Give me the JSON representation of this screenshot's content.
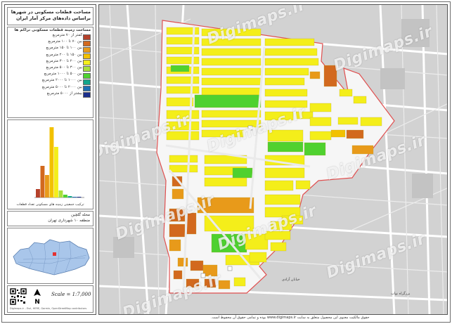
{
  "title": {
    "line1": "مساحت قطعات مسکونی در شهرها",
    "line2": "براساس داده‌های مرکز آمار ایران"
  },
  "legend": {
    "heading": "مساحت زمینه قطعات مسکونی تراکم ها",
    "items": [
      {
        "label": "کمتر از ۷۰ مترمربع",
        "color": "#b5412b"
      },
      {
        "label": "بین ۷۰ تا ۱۰۰ مترمربع",
        "color": "#d2691e"
      },
      {
        "label": "بین ۱۰۰ تا ۱۵۰ مترمربع",
        "color": "#e89a1a"
      },
      {
        "label": "بین ۱۵۰ تا ۲۰۰ مترمربع",
        "color": "#f2c100"
      },
      {
        "label": "بین ۲۰۰ تا ۳۰۰ مترمربع",
        "color": "#f4ee1a"
      },
      {
        "label": "بین ۳۰۰ تا ۵۰۰ مترمربع",
        "color": "#a7e03c"
      },
      {
        "label": "بین ۵۰۰ تا ۱۰۰۰ مترمربع",
        "color": "#4fd12f"
      },
      {
        "label": "بین ۱۰۰۰ تا ۲۰۰۰ مترمربع",
        "color": "#13a68b"
      },
      {
        "label": "بین ۲۰۰۰ تا ۵۰۰۰ مترمربع",
        "color": "#1e6fb5"
      },
      {
        "label": "بیشتر از ۵۰۰۰ مترمربع",
        "color": "#1b2e8c"
      }
    ]
  },
  "histogram": {
    "caption": "ترکیب جمعیتی زمینه های مسکونی تعداد قطعات",
    "values": [
      12,
      45,
      32,
      100,
      72,
      10,
      4,
      2,
      1,
      1
    ]
  },
  "area": {
    "name": "محله گلچین",
    "district": "منطقه ۱۰ شهرداری تهران"
  },
  "scale_text": "Scale = 1:7,000",
  "north_label": "N",
  "copyright": "Digimaps.ir – Esri, HERE, Garmin, OpenStreetMap contributors",
  "watermark": "Digimaps.ir",
  "street_labels": [
    "خیابان آزادی",
    "بزرگراه نواب"
  ],
  "footer": "حقوق مالکیت معنوی این محصول متعلق به سایت www.digimaps.ir بوده و تمامی حقوق آن محفوظ است."
}
